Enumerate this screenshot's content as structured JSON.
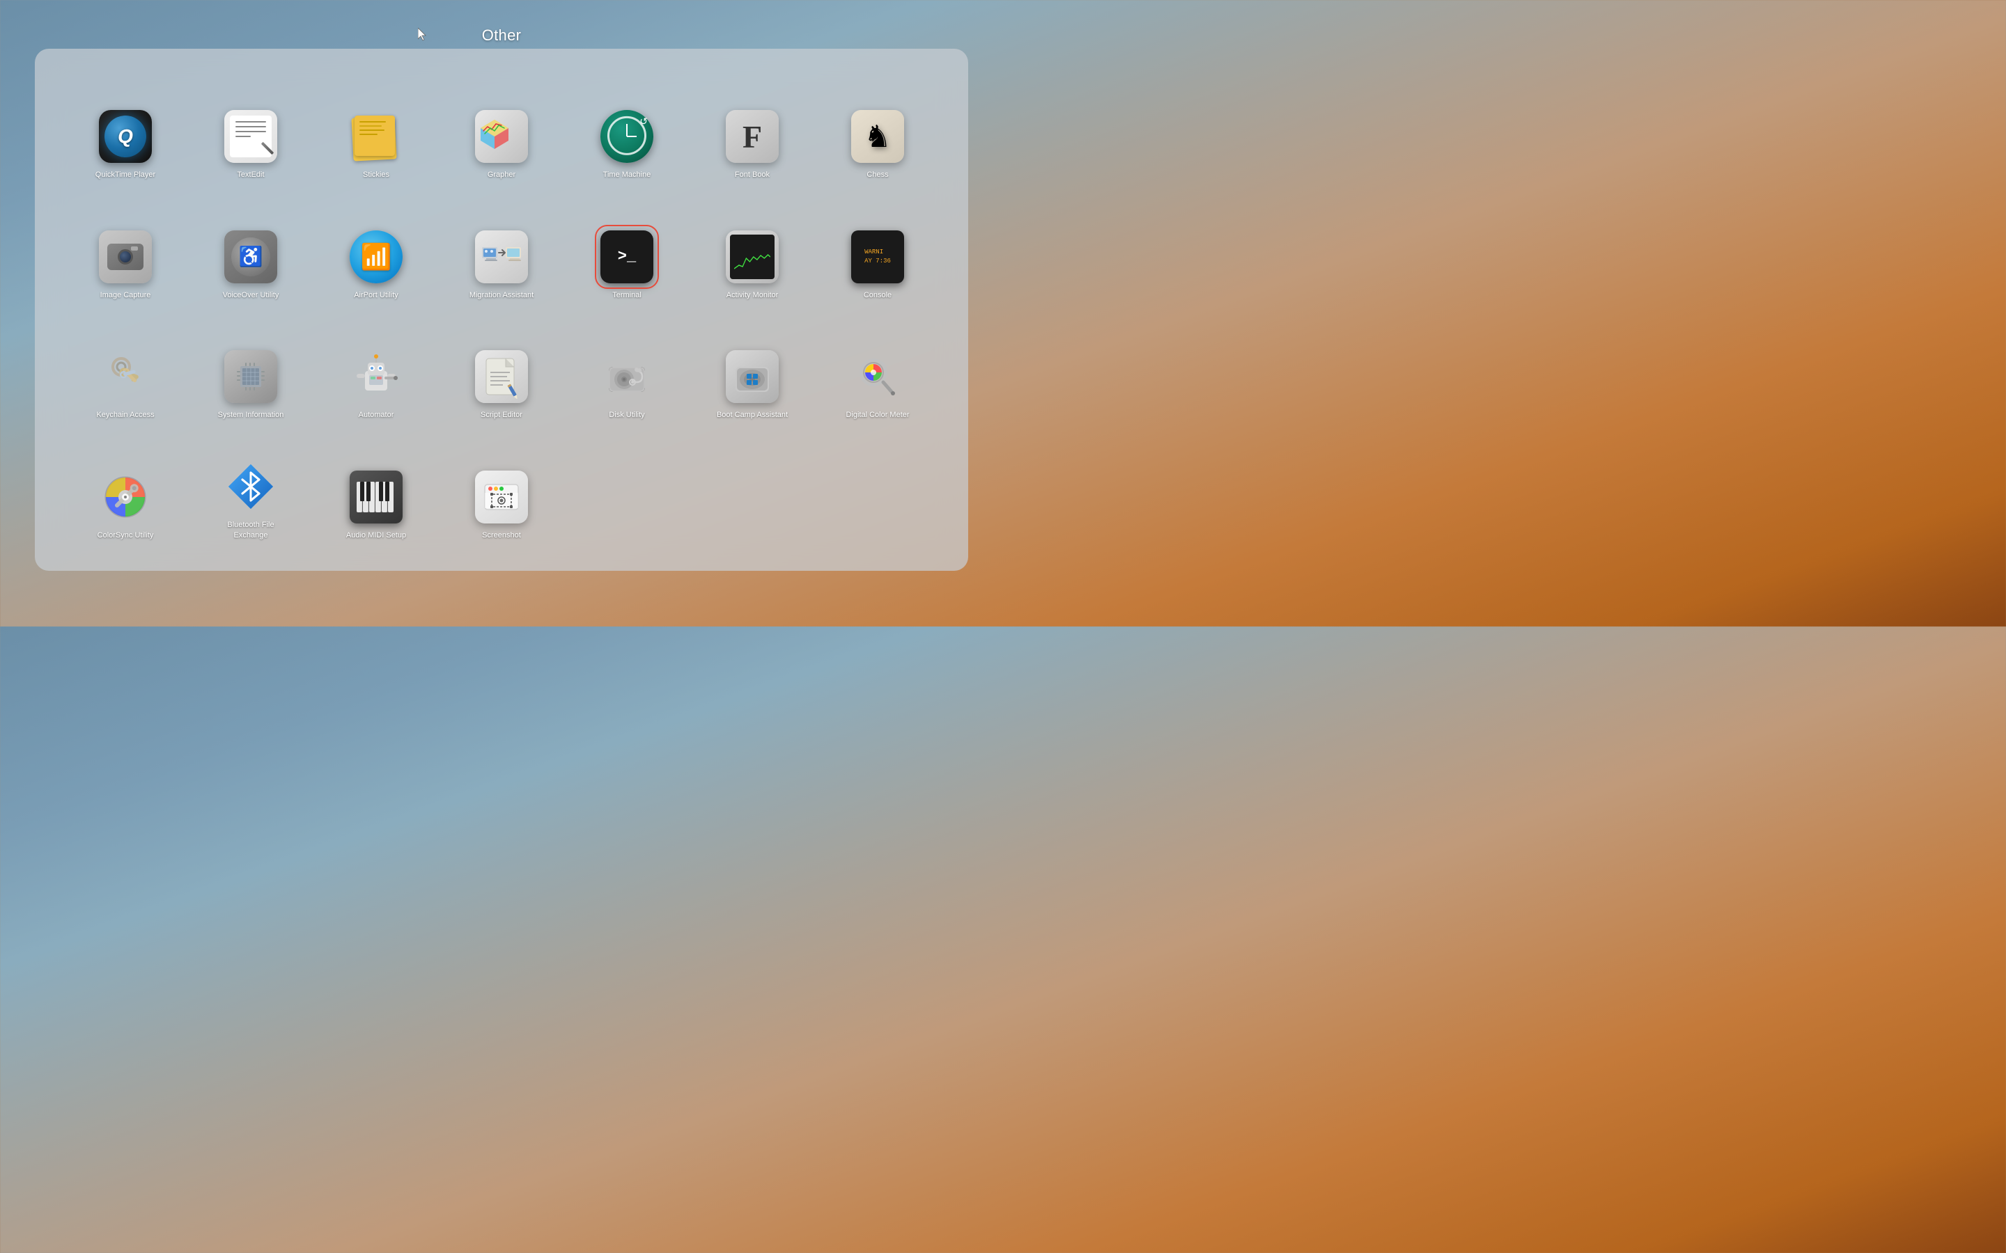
{
  "title": "Other",
  "cursor": {
    "visible": true
  },
  "apps": [
    {
      "id": "quicktime-player",
      "label": "QuickTime Player",
      "row": 0,
      "col": 0
    },
    {
      "id": "textedit",
      "label": "TextEdit",
      "row": 0,
      "col": 1
    },
    {
      "id": "stickies",
      "label": "Stickies",
      "row": 0,
      "col": 2
    },
    {
      "id": "grapher",
      "label": "Grapher",
      "row": 0,
      "col": 3
    },
    {
      "id": "time-machine",
      "label": "Time Machine",
      "row": 0,
      "col": 4
    },
    {
      "id": "font-book",
      "label": "Font Book",
      "row": 0,
      "col": 5
    },
    {
      "id": "chess",
      "label": "Chess",
      "row": 0,
      "col": 6
    },
    {
      "id": "image-capture",
      "label": "Image Capture",
      "row": 1,
      "col": 0
    },
    {
      "id": "voiceover-utility",
      "label": "VoiceOver Utility",
      "row": 1,
      "col": 1
    },
    {
      "id": "airport-utility",
      "label": "AirPort Utility",
      "row": 1,
      "col": 2
    },
    {
      "id": "migration-assistant",
      "label": "Migration Assistant",
      "row": 1,
      "col": 3
    },
    {
      "id": "terminal",
      "label": "Terminal",
      "row": 1,
      "col": 4,
      "selected": true
    },
    {
      "id": "activity-monitor",
      "label": "Activity Monitor",
      "row": 1,
      "col": 5
    },
    {
      "id": "console",
      "label": "Console",
      "row": 1,
      "col": 6
    },
    {
      "id": "keychain-access",
      "label": "Keychain Access",
      "row": 2,
      "col": 0
    },
    {
      "id": "system-information",
      "label": "System Information",
      "row": 2,
      "col": 1
    },
    {
      "id": "automator",
      "label": "Automator",
      "row": 2,
      "col": 2
    },
    {
      "id": "script-editor",
      "label": "Script Editor",
      "row": 2,
      "col": 3
    },
    {
      "id": "disk-utility",
      "label": "Disk Utility",
      "row": 2,
      "col": 4
    },
    {
      "id": "boot-camp-assistant",
      "label": "Boot Camp Assistant",
      "row": 2,
      "col": 5
    },
    {
      "id": "digital-color-meter",
      "label": "Digital Color Meter",
      "row": 2,
      "col": 6
    },
    {
      "id": "colorsync-utility",
      "label": "ColorSync Utility",
      "row": 3,
      "col": 0
    },
    {
      "id": "bluetooth-file-exchange",
      "label": "Bluetooth File Exchange",
      "row": 3,
      "col": 1
    },
    {
      "id": "audio-midi-setup",
      "label": "Audio MIDI Setup",
      "row": 3,
      "col": 2
    },
    {
      "id": "screenshot",
      "label": "Screenshot",
      "row": 3,
      "col": 3
    }
  ]
}
